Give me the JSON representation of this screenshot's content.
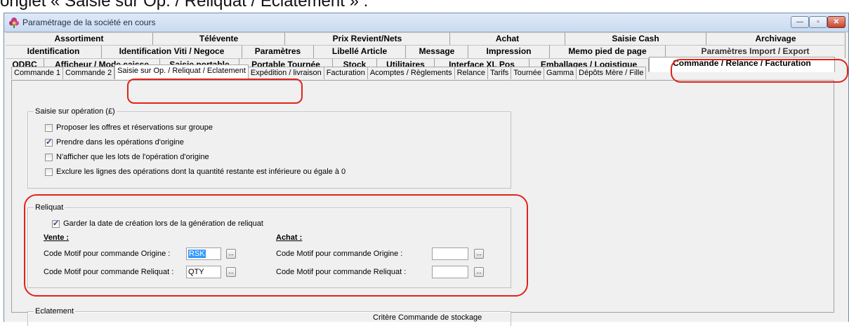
{
  "caption": "onglet « Saisie sur Op. / Reliquat / Eclatement » :",
  "window": {
    "title": "Paramétrage de la société en cours",
    "btn_min": "—",
    "btn_max": "▫",
    "btn_close": "✕"
  },
  "tabs_row1": [
    "Assortiment",
    "Télévente",
    "Prix Revient/Nets",
    "Achat",
    "Saisie Cash",
    "Archivage"
  ],
  "tabs_row2": [
    "Identification",
    "Identification Viti / Negoce",
    "Paramètres",
    "Libellé Article",
    "Message",
    "Impression",
    "Memo pied de page",
    "Paramètres Import / Export"
  ],
  "tabs_row3": [
    "ODBC",
    "Afficheur / Mode caisse",
    "Saisie portable",
    "Portable Tournée",
    "Stock",
    "Utilitaires",
    "Interface XL Pos",
    "Emballages / Logistique",
    "Commande / Relance / Facturation"
  ],
  "subtabs": [
    "Commande 1",
    "Commande 2",
    "Saisie sur Op.  / Reliquat / Eclatement",
    "Expédition / livraison",
    "Facturation",
    "Acomptes / Règlements",
    "Relance",
    "Tarifs",
    "Tournée",
    "Gamma",
    "Dépôts Mère / Fille"
  ],
  "saisie": {
    "title": "Saisie sur opération (£)",
    "options": [
      {
        "label": "Proposer les offres et réservations sur groupe",
        "checked": false
      },
      {
        "label": "Prendre dans les opérations d'origine",
        "checked": true
      },
      {
        "label": "N'afficher que les lots de l'opération d'origine",
        "checked": false
      },
      {
        "label": "Exclure les lignes des opérations dont la quantité restante est inférieure ou égale à 0",
        "checked": false
      }
    ]
  },
  "reliquat": {
    "title": "Reliquat",
    "keep_date_label": "Garder la date de création lors de la génération de reliquat",
    "keep_date_checked": true,
    "vente_header": "Vente :",
    "achat_header": "Achat :",
    "origine_label": "Code Motif pour commande Origine :",
    "reliquat_label": "Code Motif pour commande Reliquat :",
    "vente_origine_value": "RSK",
    "vente_reliquat_value": "QTY",
    "achat_origine_value": "",
    "achat_reliquat_value": "",
    "ellipsis": "..."
  },
  "eclatement": {
    "title": "Eclatement",
    "criteria_label": "Critère Commande de stockage"
  },
  "colors": {
    "highlight_red": "#e2231a",
    "selection_blue": "#3399ff"
  }
}
